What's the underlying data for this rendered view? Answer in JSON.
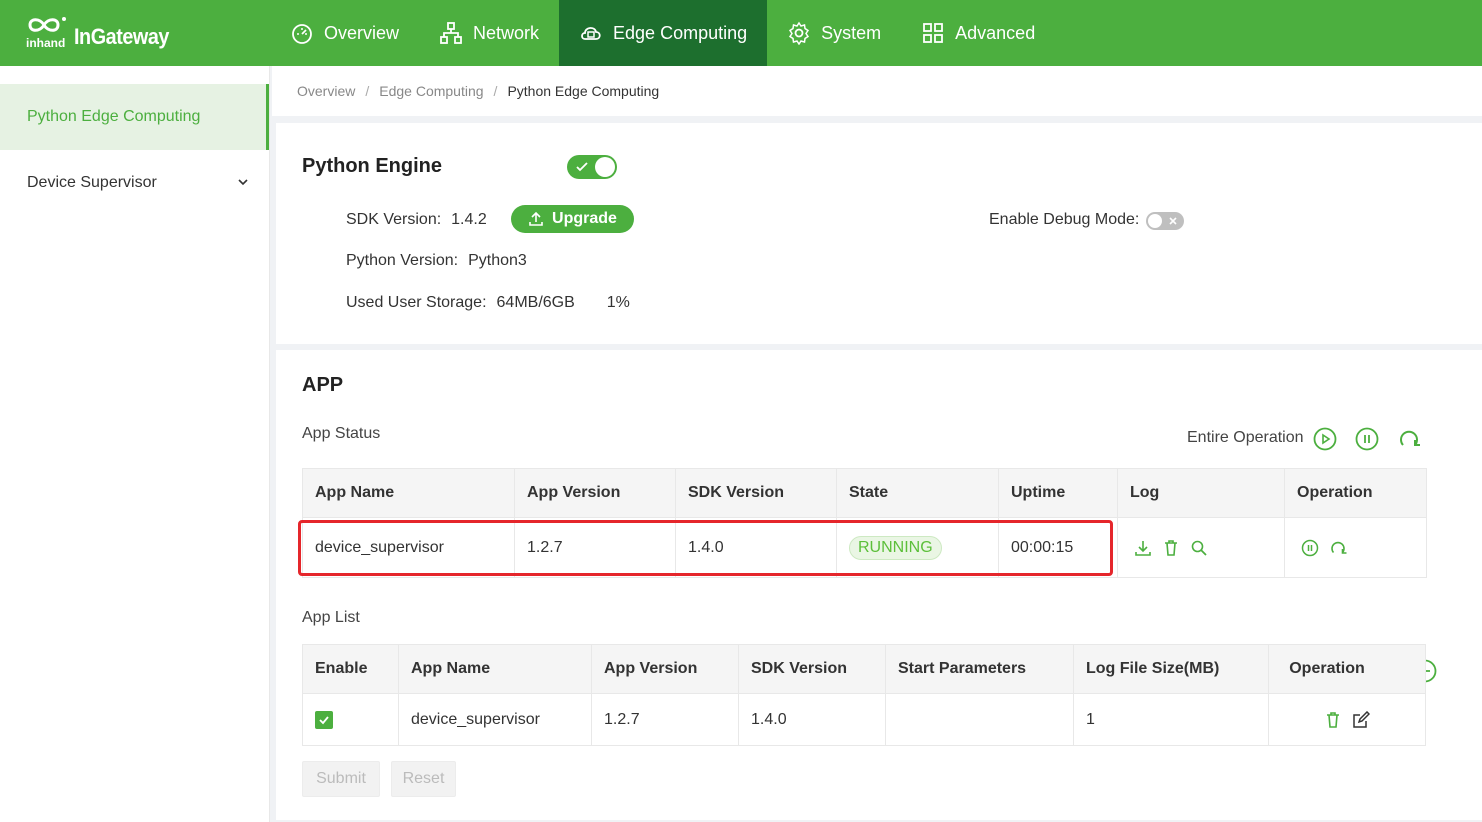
{
  "brand": {
    "logo_sub": "inhand",
    "logo_text": "InGateway"
  },
  "nav": {
    "overview": "Overview",
    "network": "Network",
    "edge": "Edge Computing",
    "system": "System",
    "advanced": "Advanced"
  },
  "sidebar": {
    "items": [
      {
        "label": "Python Edge Computing"
      },
      {
        "label": "Device Supervisor"
      }
    ]
  },
  "breadcrumb": [
    "Overview",
    "Edge Computing",
    "Python Edge Computing"
  ],
  "engine": {
    "title": "Python Engine",
    "enabled": true,
    "sdk_label": "SDK Version:",
    "sdk_value": "1.4.2",
    "upgrade": "Upgrade",
    "python_label": "Python Version:",
    "python_value": "Python3",
    "storage_label": "Used User Storage:",
    "storage_value": "64MB/6GB",
    "storage_pct": "1%",
    "debug_label": "Enable Debug Mode:",
    "debug_enabled": false
  },
  "app": {
    "title": "APP",
    "status_label": "App Status",
    "entire_op": "Entire Operation",
    "status_columns": [
      "App Name",
      "App Version",
      "SDK Version",
      "State",
      "Uptime",
      "Log",
      "Operation"
    ],
    "status_rows": [
      {
        "name": "device_supervisor",
        "app_version": "1.2.7",
        "sdk_version": "1.4.0",
        "state": "RUNNING",
        "uptime": "00:00:15"
      }
    ],
    "list_label": "App List",
    "list_columns": [
      "Enable",
      "App Name",
      "App Version",
      "SDK Version",
      "Start Parameters",
      "Log File Size(MB)",
      "Operation"
    ],
    "list_rows": [
      {
        "enabled": true,
        "name": "device_supervisor",
        "app_version": "1.2.7",
        "sdk_version": "1.4.0",
        "start_params": "",
        "log_size": "1"
      }
    ],
    "submit": "Submit",
    "reset": "Reset"
  },
  "colors": {
    "brand_green": "#4caf3f",
    "active_nav": "#1d6f2e",
    "highlight": "#e5262b"
  }
}
